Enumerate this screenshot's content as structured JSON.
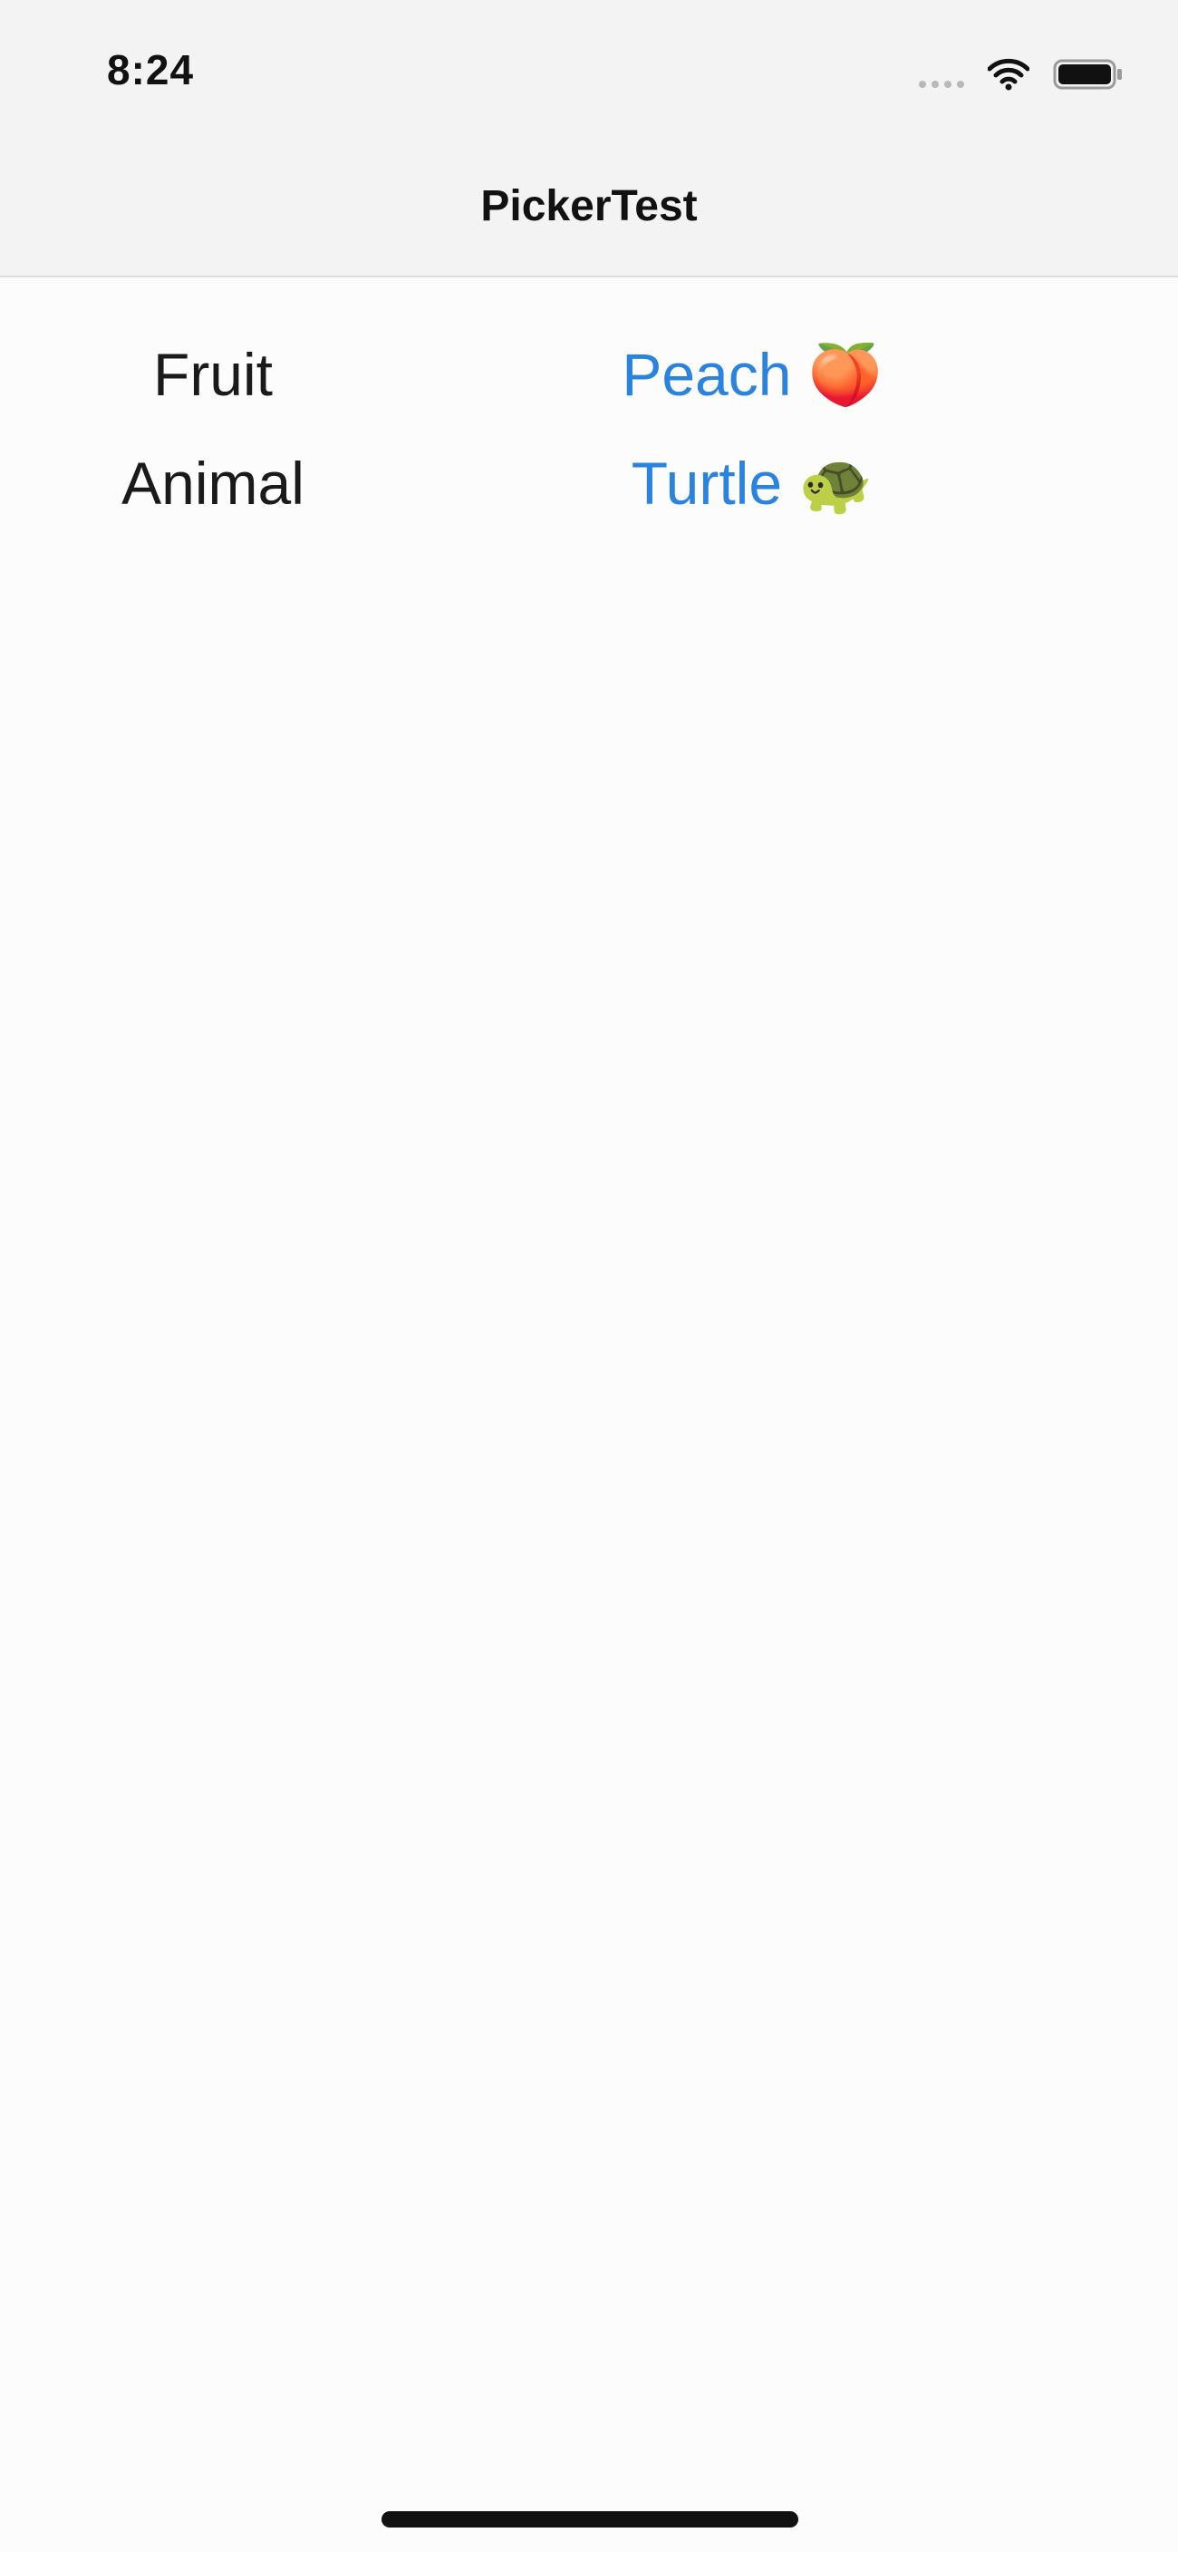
{
  "status_bar": {
    "time": "8:24",
    "icons": [
      "cellular-signal-icon",
      "wifi-icon",
      "battery-icon"
    ]
  },
  "nav": {
    "title": "PickerTest"
  },
  "rows": [
    {
      "label": "Fruit",
      "value": "Peach",
      "emoji": "🍑"
    },
    {
      "label": "Animal",
      "value": "Turtle",
      "emoji": "🐢"
    }
  ],
  "colors": {
    "accent": "#2a84df",
    "text": "#1a1a1a",
    "bar_background": "#f3f3f3",
    "background": "#fcfcfc"
  }
}
